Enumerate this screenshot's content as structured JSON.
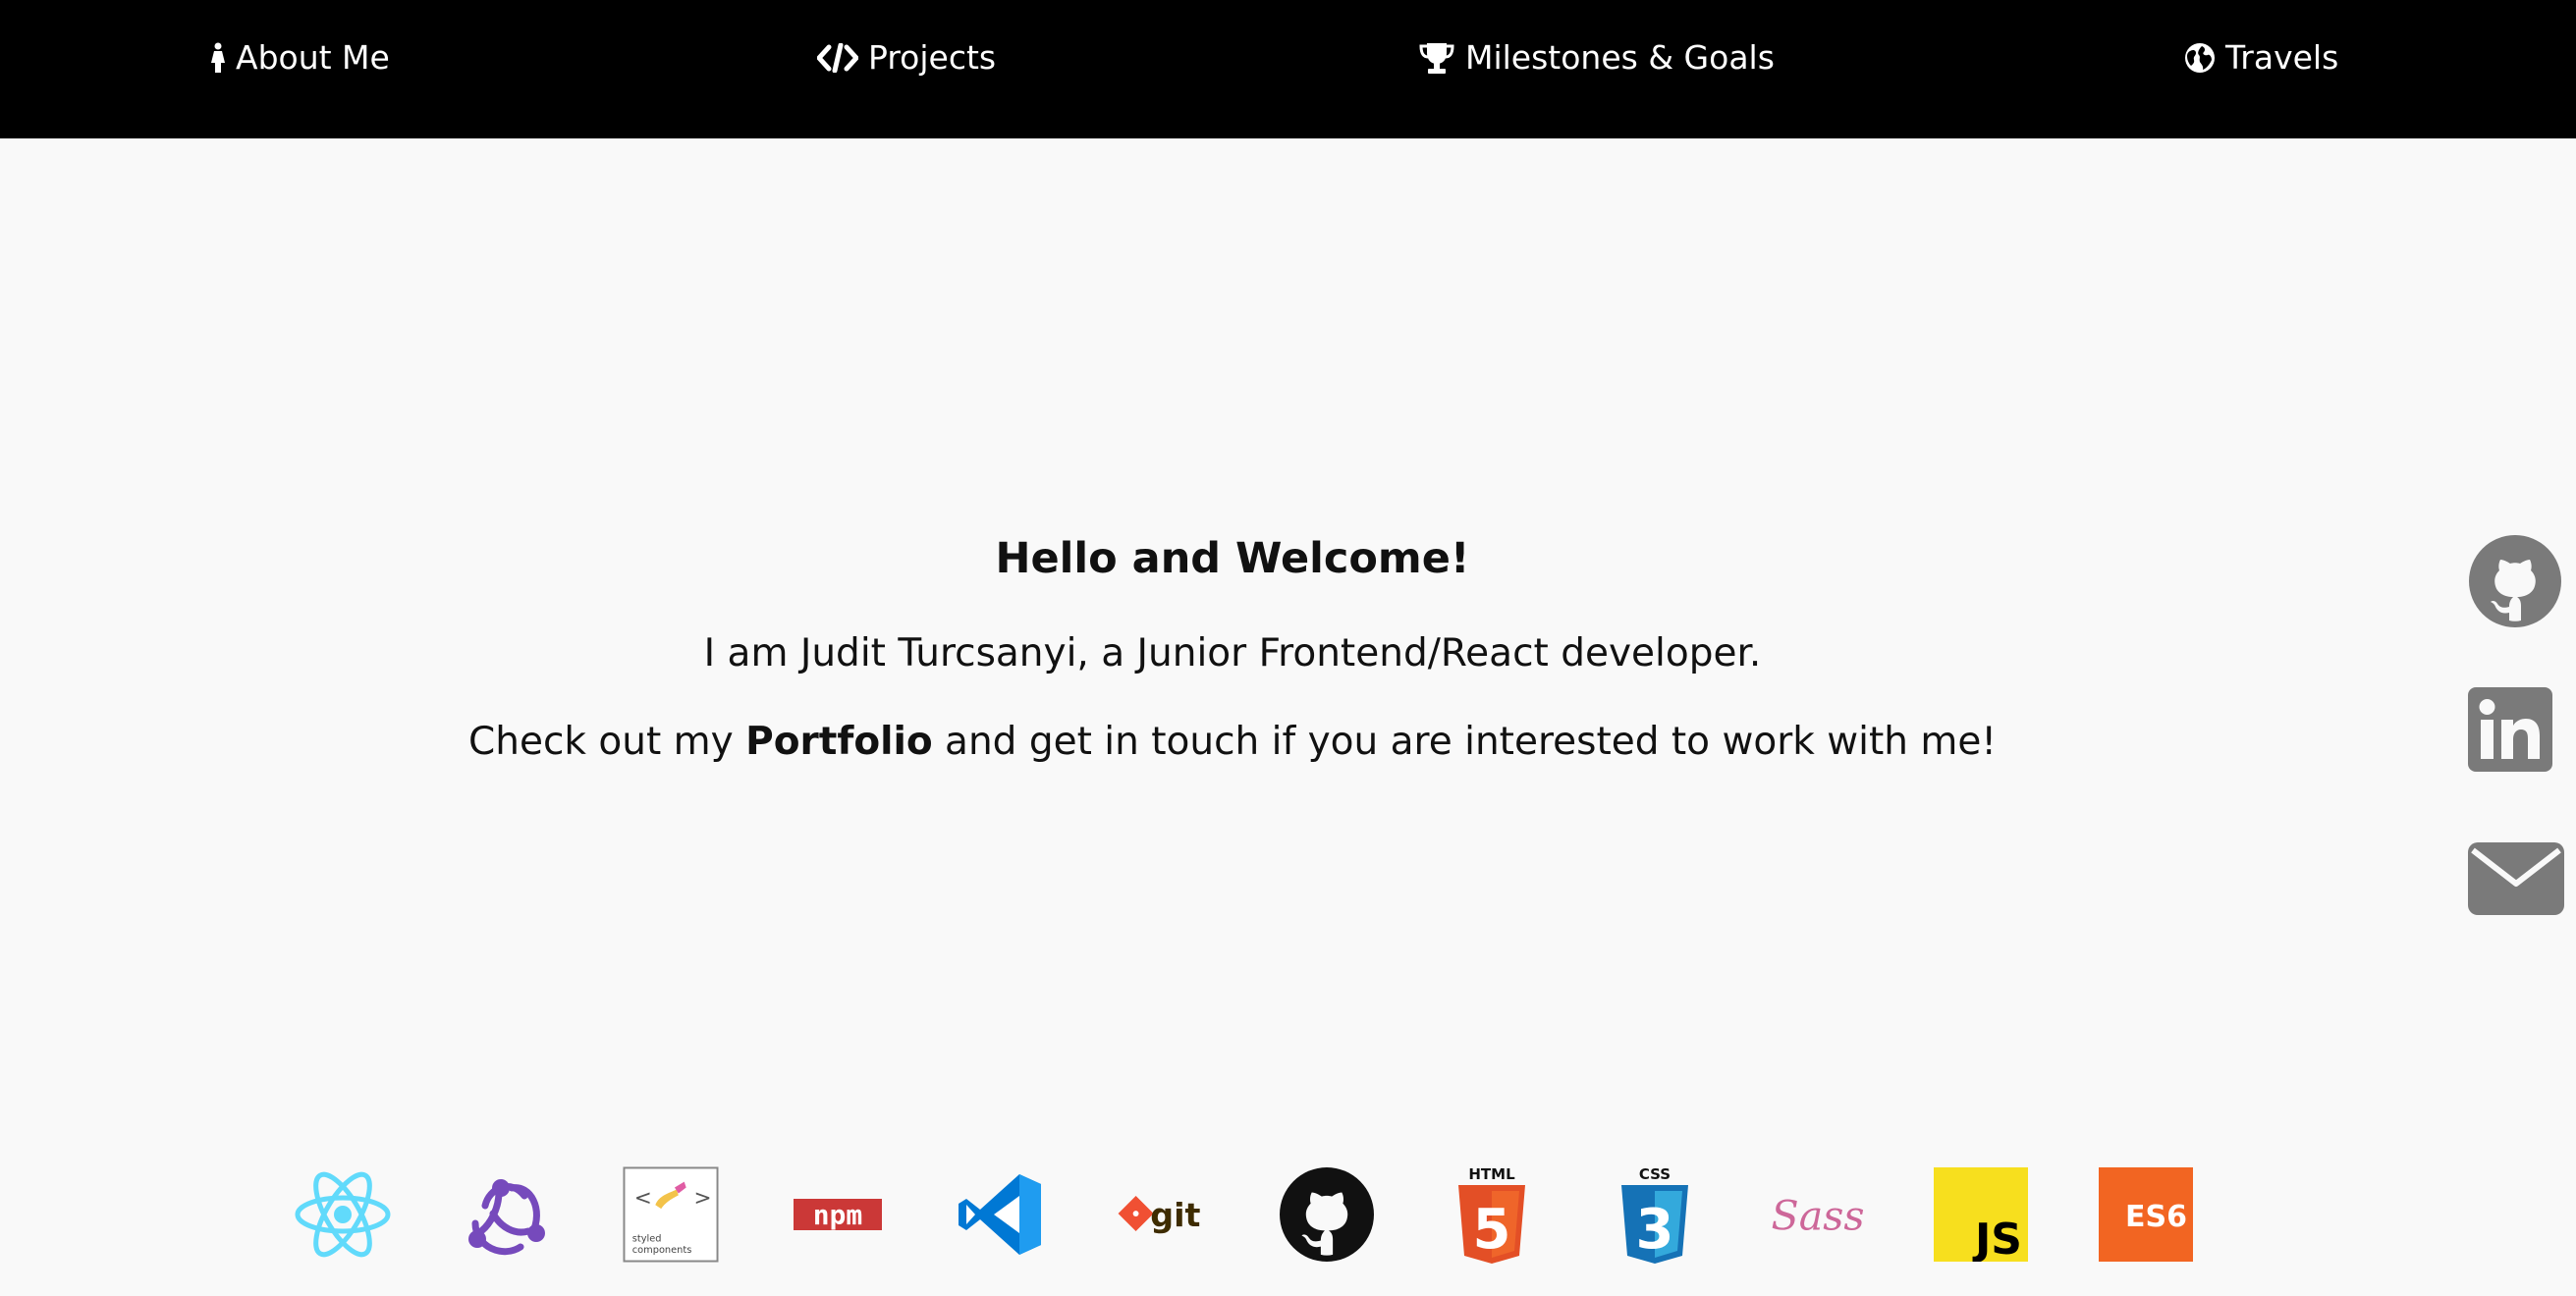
{
  "nav": {
    "items": [
      {
        "label": "About Me",
        "icon": "female-person-icon"
      },
      {
        "label": "Projects",
        "icon": "code-icon"
      },
      {
        "label": "Milestones & Goals",
        "icon": "trophy-icon"
      },
      {
        "label": "Travels",
        "icon": "globe-icon"
      }
    ]
  },
  "hero": {
    "title": "Hello and Welcome!",
    "intro": "I am Judit Turcsanyi, a Junior Frontend/React developer.",
    "cta_before": "Check out my ",
    "cta_link": "Portfolio",
    "cta_after": " and get in touch if you are interested to work with me!"
  },
  "social": [
    {
      "icon": "github-icon"
    },
    {
      "icon": "linkedin-icon"
    },
    {
      "icon": "email-icon"
    }
  ],
  "tech": {
    "styled_components_line1": "styled",
    "styled_components_line2": "components",
    "npm": "npm",
    "git": "git",
    "html": "HTML",
    "html_number": "5",
    "css": "CSS",
    "css_number": "3",
    "sass": "Sass",
    "js": "JS",
    "es6": "ES6"
  },
  "colors": {
    "nav_bg": "#000000",
    "page_bg": "#f9f9f9",
    "social_gray": "#7a7a7a",
    "react": "#61dafb",
    "redux": "#764abc",
    "npm": "#cb3837",
    "vscode": "#0078d4",
    "git": "#f05033",
    "html5": "#e34f26",
    "css3": "#1572b6",
    "sass": "#cd6799",
    "js": "#f7df1e",
    "es6": "#f26522"
  }
}
